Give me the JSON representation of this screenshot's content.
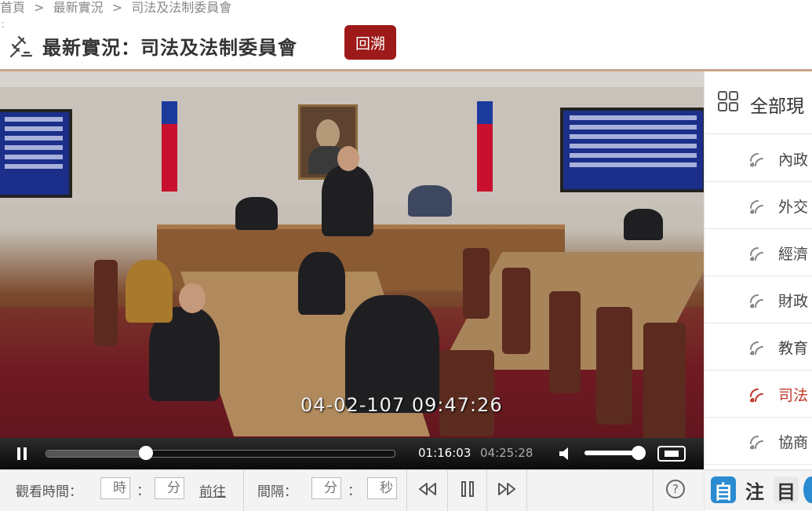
{
  "breadcrumb": [
    "首頁",
    ">",
    "最新實況",
    ">",
    "司法及法制委員會"
  ],
  "header": {
    "title": "最新實況：司法及法制委員會",
    "back_label": "回溯",
    "back_color": "#9e1a1a"
  },
  "video": {
    "overlay_timestamp": "04-02-107  09:47:26"
  },
  "player": {
    "current_time": "01:16:03",
    "total_time": "04:25:28",
    "progress_fraction": 0.287,
    "volume_fraction": 0.93
  },
  "toolbar": {
    "watch_time_label": "觀看時間：",
    "hour_placeholder": "時",
    "minute_placeholder": "分",
    "colon": "：",
    "go_label": "前往",
    "interval_label": "間隔：",
    "interval_min_placeholder": "分",
    "interval_sec_placeholder": "秒",
    "help_label": "?"
  },
  "sidebar": {
    "title": "全部現",
    "items": [
      {
        "label": "內政",
        "active": false
      },
      {
        "label": "外交",
        "active": false
      },
      {
        "label": "經濟",
        "active": false
      },
      {
        "label": "財政",
        "active": false
      },
      {
        "label": "教育",
        "active": false
      },
      {
        "label": "司法",
        "active": true
      },
      {
        "label": "協商",
        "active": false
      }
    ],
    "footer_buttons": [
      "自",
      "注",
      "目"
    ]
  },
  "colors": {
    "accent_red": "#c0392b",
    "divider": "#c9a58a"
  }
}
